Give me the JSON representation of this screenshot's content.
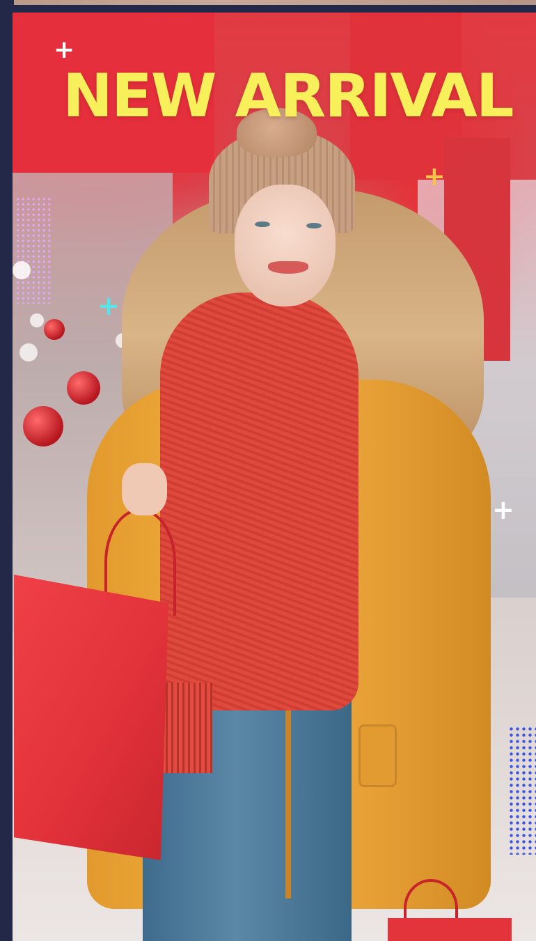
{
  "headline": "NEW ARRIVAL",
  "colors": {
    "headline": "#f7f05a",
    "frame": "#232748",
    "accent_red": "#e2323a",
    "coat_orange": "#f1ac3a",
    "dots_pink": "#e6a6ff",
    "dots_blue": "#3a53e6",
    "plus_cyan": "#54e6e8",
    "plus_yellow": "#f7c34a",
    "plus_white": "#ffffff"
  },
  "decor": {
    "plus_glyph": "+"
  }
}
